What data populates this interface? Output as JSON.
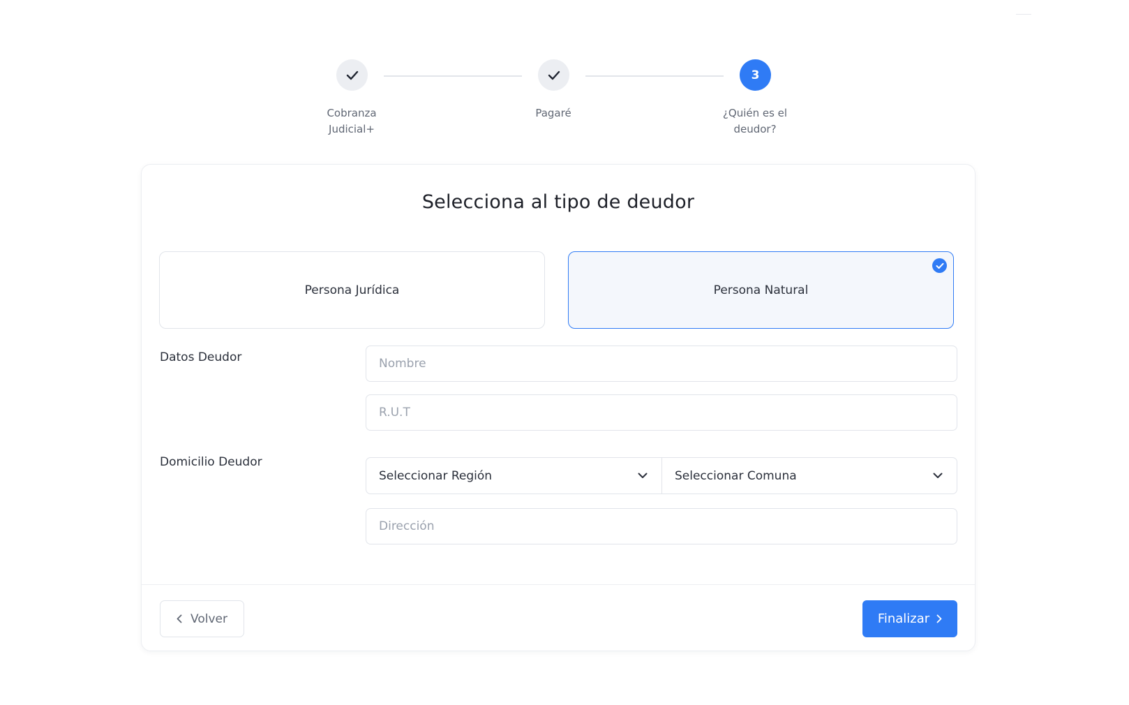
{
  "stepper": {
    "steps": [
      {
        "label_line1": "Cobranza",
        "label_line2": "Judicial+",
        "state": "done",
        "icon": "check-icon"
      },
      {
        "label_line1": "Pagaré",
        "label_line2": "",
        "state": "done",
        "icon": "check-icon"
      },
      {
        "number": "3",
        "label_line1": "¿Quién es el",
        "label_line2": "deudor?",
        "state": "active"
      }
    ]
  },
  "card": {
    "title": "Selecciona al tipo de deudor",
    "options": [
      {
        "label": "Persona Jurídica",
        "selected": false
      },
      {
        "label": "Persona Natural",
        "selected": true
      }
    ],
    "datos_label": "Datos Deudor",
    "nombre_placeholder": "Nombre",
    "rut_placeholder": "R.U.T",
    "domicilio_label": "Domicilio Deudor",
    "region_select": "Seleccionar Región",
    "comuna_select": "Seleccionar Comuna",
    "direccion_placeholder": "Dirección"
  },
  "footer": {
    "back_label": "Volver",
    "finish_label": "Finalizar"
  },
  "colors": {
    "accent": "#2f7bf5",
    "done_step_bg": "#eceef2",
    "border": "#e1e4ea",
    "selected_bg": "#f4f7fc"
  }
}
